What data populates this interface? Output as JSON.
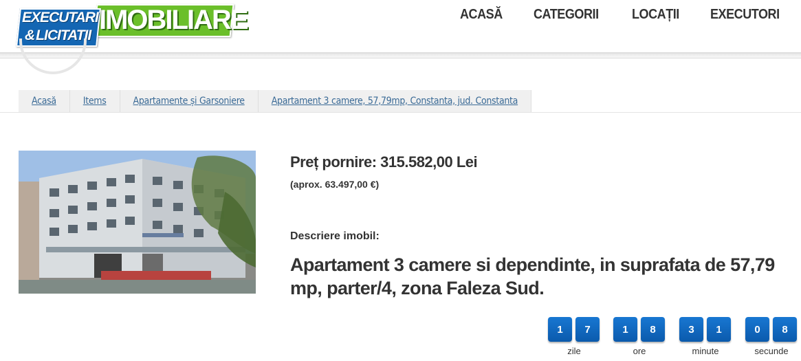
{
  "header": {
    "logo": {
      "line1": "EXECUTARI",
      "line2_amp": "&",
      "line2": "LICITATII",
      "word": "IMOBILIARE"
    },
    "nav": [
      "ACASĂ",
      "CATEGORII",
      "LOCAȚII",
      "EXECUTORI"
    ]
  },
  "breadcrumb": [
    "Acasă",
    "Items",
    "Apartamente și Garsoniere",
    "Apartament 3 camere, 57,79mp, Constanta, jud. Constanta"
  ],
  "listing": {
    "price": "Preț pornire: 315.582,00 Lei",
    "price_approx": "(aprox. 63.497,00 €)",
    "description_label": "Descriere imobil:",
    "description": "Apartament 3 camere si dependinte, in suprafata de 57,79 mp, parter/4, zona Faleza Sud."
  },
  "countdown": {
    "days": [
      "1",
      "7"
    ],
    "hours": [
      "1",
      "8"
    ],
    "minutes": [
      "3",
      "1"
    ],
    "seconds": [
      "0",
      "8"
    ],
    "labels": {
      "days": "zile",
      "hours": "ore",
      "minutes": "minute",
      "seconds": "secunde"
    },
    "digit_color": "#1466b3"
  },
  "colors": {
    "logo_blue": "#1466b3",
    "logo_green": "#6bbf2a",
    "link": "#3a6a96"
  }
}
